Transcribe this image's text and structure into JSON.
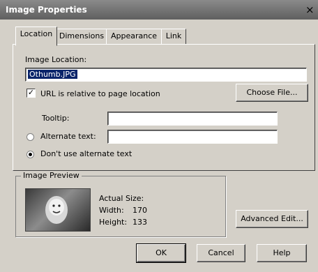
{
  "window": {
    "title": "Image Properties",
    "close_glyph": "×"
  },
  "tabs": [
    {
      "label": "Location",
      "active": true
    },
    {
      "label": "Dimensions",
      "active": false
    },
    {
      "label": "Appearance",
      "active": false
    },
    {
      "label": "Link",
      "active": false
    }
  ],
  "location": {
    "image_location_label": "Image Location:",
    "image_location_value": "Othumb.JPG",
    "relative_label": "URL is relative to page location",
    "relative_checked": true,
    "choose_file_label": "Choose File...",
    "tooltip_label": "Tooltip:",
    "tooltip_value": "",
    "alt_text_label": "Alternate text:",
    "alt_text_value": "",
    "alt_selected": false,
    "no_alt_label": "Don't use alternate text",
    "no_alt_selected": true
  },
  "preview": {
    "group_label": "Image Preview",
    "actual_size_label": "Actual Size:",
    "width_label": "Width:",
    "width_value": "170",
    "height_label": "Height:",
    "height_value": "133"
  },
  "buttons": {
    "advanced_edit": "Advanced Edit...",
    "ok": "OK",
    "cancel": "Cancel",
    "help": "Help"
  },
  "icons": {
    "check": "✓",
    "close": "close-icon"
  }
}
